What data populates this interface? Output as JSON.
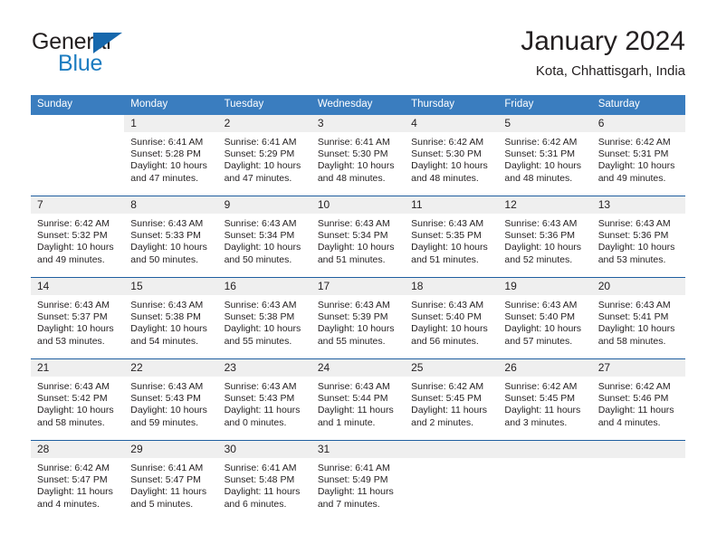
{
  "brand": {
    "name_top": "General",
    "name_bottom": "Blue",
    "accent_color": "#1c7cc0",
    "triangle_color": "#1668ad"
  },
  "header": {
    "title": "January 2024",
    "subtitle": "Kota, Chhattisgarh, India"
  },
  "theme": {
    "header_bg": "#3a7dbf",
    "header_text": "#ffffff",
    "daynum_bg": "#efefef",
    "row_divider": "#1f5fa0",
    "body_text": "#231f20"
  },
  "calendar": {
    "weekday_headers": [
      "Sunday",
      "Monday",
      "Tuesday",
      "Wednesday",
      "Thursday",
      "Friday",
      "Saturday"
    ],
    "labels": {
      "sunrise": "Sunrise:",
      "sunset": "Sunset:",
      "daylight": "Daylight:"
    },
    "weeks": [
      [
        {
          "day": "",
          "blank": true,
          "sunrise": "",
          "sunset": "",
          "daylight1": "",
          "daylight2": ""
        },
        {
          "day": "1",
          "sunrise": "Sunrise: 6:41 AM",
          "sunset": "Sunset: 5:28 PM",
          "daylight1": "Daylight: 10 hours",
          "daylight2": "and 47 minutes."
        },
        {
          "day": "2",
          "sunrise": "Sunrise: 6:41 AM",
          "sunset": "Sunset: 5:29 PM",
          "daylight1": "Daylight: 10 hours",
          "daylight2": "and 47 minutes."
        },
        {
          "day": "3",
          "sunrise": "Sunrise: 6:41 AM",
          "sunset": "Sunset: 5:30 PM",
          "daylight1": "Daylight: 10 hours",
          "daylight2": "and 48 minutes."
        },
        {
          "day": "4",
          "sunrise": "Sunrise: 6:42 AM",
          "sunset": "Sunset: 5:30 PM",
          "daylight1": "Daylight: 10 hours",
          "daylight2": "and 48 minutes."
        },
        {
          "day": "5",
          "sunrise": "Sunrise: 6:42 AM",
          "sunset": "Sunset: 5:31 PM",
          "daylight1": "Daylight: 10 hours",
          "daylight2": "and 48 minutes."
        },
        {
          "day": "6",
          "sunrise": "Sunrise: 6:42 AM",
          "sunset": "Sunset: 5:31 PM",
          "daylight1": "Daylight: 10 hours",
          "daylight2": "and 49 minutes."
        }
      ],
      [
        {
          "day": "7",
          "sunrise": "Sunrise: 6:42 AM",
          "sunset": "Sunset: 5:32 PM",
          "daylight1": "Daylight: 10 hours",
          "daylight2": "and 49 minutes."
        },
        {
          "day": "8",
          "sunrise": "Sunrise: 6:43 AM",
          "sunset": "Sunset: 5:33 PM",
          "daylight1": "Daylight: 10 hours",
          "daylight2": "and 50 minutes."
        },
        {
          "day": "9",
          "sunrise": "Sunrise: 6:43 AM",
          "sunset": "Sunset: 5:34 PM",
          "daylight1": "Daylight: 10 hours",
          "daylight2": "and 50 minutes."
        },
        {
          "day": "10",
          "sunrise": "Sunrise: 6:43 AM",
          "sunset": "Sunset: 5:34 PM",
          "daylight1": "Daylight: 10 hours",
          "daylight2": "and 51 minutes."
        },
        {
          "day": "11",
          "sunrise": "Sunrise: 6:43 AM",
          "sunset": "Sunset: 5:35 PM",
          "daylight1": "Daylight: 10 hours",
          "daylight2": "and 51 minutes."
        },
        {
          "day": "12",
          "sunrise": "Sunrise: 6:43 AM",
          "sunset": "Sunset: 5:36 PM",
          "daylight1": "Daylight: 10 hours",
          "daylight2": "and 52 minutes."
        },
        {
          "day": "13",
          "sunrise": "Sunrise: 6:43 AM",
          "sunset": "Sunset: 5:36 PM",
          "daylight1": "Daylight: 10 hours",
          "daylight2": "and 53 minutes."
        }
      ],
      [
        {
          "day": "14",
          "sunrise": "Sunrise: 6:43 AM",
          "sunset": "Sunset: 5:37 PM",
          "daylight1": "Daylight: 10 hours",
          "daylight2": "and 53 minutes."
        },
        {
          "day": "15",
          "sunrise": "Sunrise: 6:43 AM",
          "sunset": "Sunset: 5:38 PM",
          "daylight1": "Daylight: 10 hours",
          "daylight2": "and 54 minutes."
        },
        {
          "day": "16",
          "sunrise": "Sunrise: 6:43 AM",
          "sunset": "Sunset: 5:38 PM",
          "daylight1": "Daylight: 10 hours",
          "daylight2": "and 55 minutes."
        },
        {
          "day": "17",
          "sunrise": "Sunrise: 6:43 AM",
          "sunset": "Sunset: 5:39 PM",
          "daylight1": "Daylight: 10 hours",
          "daylight2": "and 55 minutes."
        },
        {
          "day": "18",
          "sunrise": "Sunrise: 6:43 AM",
          "sunset": "Sunset: 5:40 PM",
          "daylight1": "Daylight: 10 hours",
          "daylight2": "and 56 minutes."
        },
        {
          "day": "19",
          "sunrise": "Sunrise: 6:43 AM",
          "sunset": "Sunset: 5:40 PM",
          "daylight1": "Daylight: 10 hours",
          "daylight2": "and 57 minutes."
        },
        {
          "day": "20",
          "sunrise": "Sunrise: 6:43 AM",
          "sunset": "Sunset: 5:41 PM",
          "daylight1": "Daylight: 10 hours",
          "daylight2": "and 58 minutes."
        }
      ],
      [
        {
          "day": "21",
          "sunrise": "Sunrise: 6:43 AM",
          "sunset": "Sunset: 5:42 PM",
          "daylight1": "Daylight: 10 hours",
          "daylight2": "and 58 minutes."
        },
        {
          "day": "22",
          "sunrise": "Sunrise: 6:43 AM",
          "sunset": "Sunset: 5:43 PM",
          "daylight1": "Daylight: 10 hours",
          "daylight2": "and 59 minutes."
        },
        {
          "day": "23",
          "sunrise": "Sunrise: 6:43 AM",
          "sunset": "Sunset: 5:43 PM",
          "daylight1": "Daylight: 11 hours",
          "daylight2": "and 0 minutes."
        },
        {
          "day": "24",
          "sunrise": "Sunrise: 6:43 AM",
          "sunset": "Sunset: 5:44 PM",
          "daylight1": "Daylight: 11 hours",
          "daylight2": "and 1 minute."
        },
        {
          "day": "25",
          "sunrise": "Sunrise: 6:42 AM",
          "sunset": "Sunset: 5:45 PM",
          "daylight1": "Daylight: 11 hours",
          "daylight2": "and 2 minutes."
        },
        {
          "day": "26",
          "sunrise": "Sunrise: 6:42 AM",
          "sunset": "Sunset: 5:45 PM",
          "daylight1": "Daylight: 11 hours",
          "daylight2": "and 3 minutes."
        },
        {
          "day": "27",
          "sunrise": "Sunrise: 6:42 AM",
          "sunset": "Sunset: 5:46 PM",
          "daylight1": "Daylight: 11 hours",
          "daylight2": "and 4 minutes."
        }
      ],
      [
        {
          "day": "28",
          "sunrise": "Sunrise: 6:42 AM",
          "sunset": "Sunset: 5:47 PM",
          "daylight1": "Daylight: 11 hours",
          "daylight2": "and 4 minutes."
        },
        {
          "day": "29",
          "sunrise": "Sunrise: 6:41 AM",
          "sunset": "Sunset: 5:47 PM",
          "daylight1": "Daylight: 11 hours",
          "daylight2": "and 5 minutes."
        },
        {
          "day": "30",
          "sunrise": "Sunrise: 6:41 AM",
          "sunset": "Sunset: 5:48 PM",
          "daylight1": "Daylight: 11 hours",
          "daylight2": "and 6 minutes."
        },
        {
          "day": "31",
          "sunrise": "Sunrise: 6:41 AM",
          "sunset": "Sunset: 5:49 PM",
          "daylight1": "Daylight: 11 hours",
          "daylight2": "and 7 minutes."
        },
        {
          "day": "",
          "empty": true,
          "sunrise": "",
          "sunset": "",
          "daylight1": "",
          "daylight2": ""
        },
        {
          "day": "",
          "empty": true,
          "sunrise": "",
          "sunset": "",
          "daylight1": "",
          "daylight2": ""
        },
        {
          "day": "",
          "empty": true,
          "sunrise": "",
          "sunset": "",
          "daylight1": "",
          "daylight2": ""
        }
      ]
    ]
  }
}
